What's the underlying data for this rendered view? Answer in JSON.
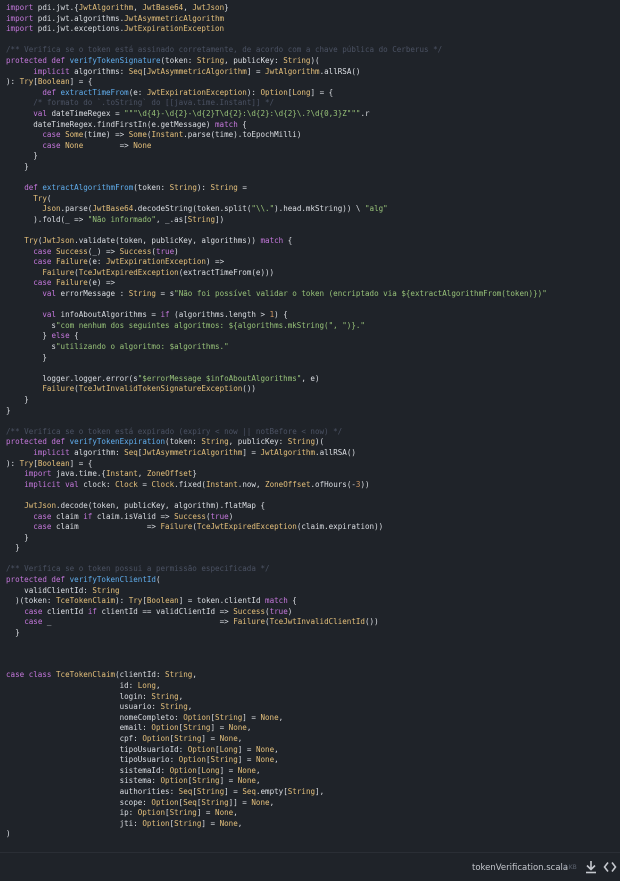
{
  "file": {
    "name": "tokenVerification.scala",
    "size": "4 KB"
  },
  "icons": {
    "download": "download-icon",
    "embed": "code-embed-icon"
  },
  "colors": {
    "background": "#1f2329",
    "keyword": "#c678dd",
    "function": "#61afef",
    "type": "#e5c07b",
    "string": "#98c379",
    "comment": "#4b5263",
    "number": "#d19a66",
    "plain": "#dcdfe4"
  },
  "code_lines": [
    [
      [
        "kw",
        "import"
      ],
      [
        "pl",
        " pdi.jwt.{"
      ],
      [
        "ty",
        "JwtAlgorithm"
      ],
      [
        "pl",
        ", "
      ],
      [
        "ty",
        "JwtBase64"
      ],
      [
        "pl",
        ", "
      ],
      [
        "ty",
        "JwtJson"
      ],
      [
        "pl",
        "}"
      ]
    ],
    [
      [
        "kw",
        "import"
      ],
      [
        "pl",
        " pdi.jwt.algorithms."
      ],
      [
        "ty",
        "JwtAsymmetricAlgorithm"
      ]
    ],
    [
      [
        "kw",
        "import"
      ],
      [
        "pl",
        " pdi.jwt.exceptions."
      ],
      [
        "ty",
        "JwtExpirationException"
      ]
    ],
    [],
    [
      [
        "cm",
        "/** Verifica se o token está assinado corretamente, de acordo com a chave pública do Cerberus */"
      ]
    ],
    [
      [
        "kw",
        "protected def "
      ],
      [
        "fn",
        "verifyTokenSignature"
      ],
      [
        "pl",
        "(token: "
      ],
      [
        "ty",
        "String"
      ],
      [
        "pl",
        ", publicKey: "
      ],
      [
        "ty",
        "String"
      ],
      [
        "pl",
        ")("
      ]
    ],
    [
      [
        "pl",
        "      "
      ],
      [
        "kw",
        "implicit "
      ],
      [
        "pl",
        "algorithms: "
      ],
      [
        "ty",
        "Seq"
      ],
      [
        "pl",
        "["
      ],
      [
        "ty",
        "JwtAsymmetricAlgorithm"
      ],
      [
        "pl",
        "] = "
      ],
      [
        "ty",
        "JwtAlgorithm"
      ],
      [
        "pl",
        ".allRSA()"
      ]
    ],
    [
      [
        "pl",
        "): "
      ],
      [
        "ty",
        "Try"
      ],
      [
        "pl",
        "["
      ],
      [
        "ty",
        "Boolean"
      ],
      [
        "pl",
        "] = {"
      ]
    ],
    [
      [
        "pl",
        "        "
      ],
      [
        "kw",
        "def "
      ],
      [
        "fn",
        "extractTimeFrom"
      ],
      [
        "pl",
        "(e: "
      ],
      [
        "ty",
        "JwtExpirationException"
      ],
      [
        "pl",
        "): "
      ],
      [
        "ty",
        "Option"
      ],
      [
        "pl",
        "["
      ],
      [
        "ty",
        "Long"
      ],
      [
        "pl",
        "] = {"
      ]
    ],
    [
      [
        "pl",
        "      "
      ],
      [
        "cm",
        "/* formato do `.toString` do [[java.time.Instant]] */"
      ]
    ],
    [
      [
        "pl",
        "      "
      ],
      [
        "kw",
        "val "
      ],
      [
        "pl",
        "dateTimeRegex = "
      ],
      [
        "st",
        "\"\"\"\\d{4}-\\d{2}-\\d{2}T\\d{2}:\\d{2}:\\d{2}\\.?\\d{0,3}Z\"\"\""
      ],
      [
        "pl",
        ".r"
      ]
    ],
    [
      [
        "pl",
        "      dateTimeRegex.findFirstIn(e.getMessage) "
      ],
      [
        "kw",
        "match"
      ],
      [
        "pl",
        " {"
      ]
    ],
    [
      [
        "pl",
        "        "
      ],
      [
        "kw",
        "case "
      ],
      [
        "ty",
        "Some"
      ],
      [
        "pl",
        "(time) => "
      ],
      [
        "ty",
        "Some"
      ],
      [
        "pl",
        "("
      ],
      [
        "ty",
        "Instant"
      ],
      [
        "pl",
        ".parse(time).toEpochMilli)"
      ]
    ],
    [
      [
        "pl",
        "        "
      ],
      [
        "kw",
        "case "
      ],
      [
        "ty",
        "None"
      ],
      [
        "pl",
        "        => "
      ],
      [
        "ty",
        "None"
      ]
    ],
    [
      [
        "pl",
        "      }"
      ]
    ],
    [
      [
        "pl",
        "    }"
      ]
    ],
    [],
    [
      [
        "pl",
        "    "
      ],
      [
        "kw",
        "def "
      ],
      [
        "fn",
        "extractAlgorithmFrom"
      ],
      [
        "pl",
        "(token: "
      ],
      [
        "ty",
        "String"
      ],
      [
        "pl",
        "): "
      ],
      [
        "ty",
        "String"
      ],
      [
        "pl",
        " ="
      ]
    ],
    [
      [
        "pl",
        "      "
      ],
      [
        "ty",
        "Try"
      ],
      [
        "pl",
        "("
      ]
    ],
    [
      [
        "pl",
        "        "
      ],
      [
        "ty",
        "Json"
      ],
      [
        "pl",
        ".parse("
      ],
      [
        "ty",
        "JwtBase64"
      ],
      [
        "pl",
        ".decodeString(token.split("
      ],
      [
        "st",
        "\"\\\\.\""
      ],
      [
        "pl",
        ").head.mkString)) \\ "
      ],
      [
        "st",
        "\"alg\""
      ]
    ],
    [
      [
        "pl",
        "      ).fold(_ => "
      ],
      [
        "st",
        "\"Não informado\""
      ],
      [
        "pl",
        ", _.as["
      ],
      [
        "ty",
        "String"
      ],
      [
        "pl",
        "])"
      ]
    ],
    [],
    [
      [
        "pl",
        "    "
      ],
      [
        "ty",
        "Try"
      ],
      [
        "pl",
        "("
      ],
      [
        "ty",
        "JwtJson"
      ],
      [
        "pl",
        ".validate(token, publicKey, algorithms)) "
      ],
      [
        "kw",
        "match"
      ],
      [
        "pl",
        " {"
      ]
    ],
    [
      [
        "pl",
        "      "
      ],
      [
        "kw",
        "case "
      ],
      [
        "ty",
        "Success"
      ],
      [
        "pl",
        "(_) => "
      ],
      [
        "ty",
        "Success"
      ],
      [
        "pl",
        "("
      ],
      [
        "kw",
        "true"
      ],
      [
        "pl",
        ")"
      ]
    ],
    [
      [
        "pl",
        "      "
      ],
      [
        "kw",
        "case "
      ],
      [
        "ty",
        "Failure"
      ],
      [
        "pl",
        "(e: "
      ],
      [
        "ty",
        "JwtExpirationException"
      ],
      [
        "pl",
        ") =>"
      ]
    ],
    [
      [
        "pl",
        "        "
      ],
      [
        "ty",
        "Failure"
      ],
      [
        "pl",
        "("
      ],
      [
        "ty",
        "TceJwtExpiredException"
      ],
      [
        "pl",
        "(extractTimeFrom(e)))"
      ]
    ],
    [
      [
        "pl",
        "      "
      ],
      [
        "kw",
        "case "
      ],
      [
        "ty",
        "Failure"
      ],
      [
        "pl",
        "(e) =>"
      ]
    ],
    [
      [
        "pl",
        "        "
      ],
      [
        "kw",
        "val "
      ],
      [
        "pl",
        "errorMessage : "
      ],
      [
        "ty",
        "String"
      ],
      [
        "pl",
        " = s"
      ],
      [
        "st",
        "\"Não foi possível validar o token (encriptado via ${extractAlgorithmFrom(token)})\""
      ]
    ],
    [],
    [
      [
        "pl",
        "        "
      ],
      [
        "kw",
        "val "
      ],
      [
        "pl",
        "infoAboutAlgorithms = "
      ],
      [
        "kw",
        "if"
      ],
      [
        "pl",
        " (algorithms.length > "
      ],
      [
        "nm",
        "1"
      ],
      [
        "pl",
        ") {"
      ]
    ],
    [
      [
        "pl",
        "          s"
      ],
      [
        "st",
        "\"com nenhum dos seguintes algoritmos: ${algorithms.mkString(\", \")}.\""
      ]
    ],
    [
      [
        "pl",
        "        } "
      ],
      [
        "kw",
        "else"
      ],
      [
        "pl",
        " {"
      ]
    ],
    [
      [
        "pl",
        "          s"
      ],
      [
        "st",
        "\"utilizando o algoritmo: $algorithms.\""
      ]
    ],
    [
      [
        "pl",
        "        }"
      ]
    ],
    [],
    [
      [
        "pl",
        "        logger.logger.error(s"
      ],
      [
        "st",
        "\"$errorMessage $infoAboutAlgorithms\""
      ],
      [
        "pl",
        ", e)"
      ]
    ],
    [
      [
        "pl",
        "        "
      ],
      [
        "ty",
        "Failure"
      ],
      [
        "pl",
        "("
      ],
      [
        "ty",
        "TceJwtInvalidTokenSignatureException"
      ],
      [
        "pl",
        "())"
      ]
    ],
    [
      [
        "pl",
        "    }"
      ]
    ],
    [
      [
        "pl",
        "}"
      ]
    ],
    [],
    [
      [
        "cm",
        "/** Verifica se o token está expirado (expiry < now || notBefore < now) */"
      ]
    ],
    [
      [
        "kw",
        "protected def "
      ],
      [
        "fn",
        "verifyTokenExpiration"
      ],
      [
        "pl",
        "(token: "
      ],
      [
        "ty",
        "String"
      ],
      [
        "pl",
        ", publicKey: "
      ],
      [
        "ty",
        "String"
      ],
      [
        "pl",
        ")("
      ]
    ],
    [
      [
        "pl",
        "      "
      ],
      [
        "kw",
        "implicit "
      ],
      [
        "pl",
        "algorithm: "
      ],
      [
        "ty",
        "Seq"
      ],
      [
        "pl",
        "["
      ],
      [
        "ty",
        "JwtAsymmetricAlgorithm"
      ],
      [
        "pl",
        "] = "
      ],
      [
        "ty",
        "JwtAlgorithm"
      ],
      [
        "pl",
        ".allRSA()"
      ]
    ],
    [
      [
        "pl",
        "): "
      ],
      [
        "ty",
        "Try"
      ],
      [
        "pl",
        "["
      ],
      [
        "ty",
        "Boolean"
      ],
      [
        "pl",
        "] = {"
      ]
    ],
    [
      [
        "pl",
        "    "
      ],
      [
        "kw",
        "import"
      ],
      [
        "pl",
        " java.time.{"
      ],
      [
        "ty",
        "Instant"
      ],
      [
        "pl",
        ", "
      ],
      [
        "ty",
        "ZoneOffset"
      ],
      [
        "pl",
        "}"
      ]
    ],
    [
      [
        "pl",
        "    "
      ],
      [
        "kw",
        "implicit val "
      ],
      [
        "pl",
        "clock: "
      ],
      [
        "ty",
        "Clock"
      ],
      [
        "pl",
        " = "
      ],
      [
        "ty",
        "Clock"
      ],
      [
        "pl",
        ".fixed("
      ],
      [
        "ty",
        "Instant"
      ],
      [
        "pl",
        ".now, "
      ],
      [
        "ty",
        "ZoneOffset"
      ],
      [
        "pl",
        ".ofHours(-"
      ],
      [
        "nm",
        "3"
      ],
      [
        "pl",
        "))"
      ]
    ],
    [],
    [
      [
        "pl",
        "    "
      ],
      [
        "ty",
        "JwtJson"
      ],
      [
        "pl",
        ".decode(token, publicKey, algorithm).flatMap {"
      ]
    ],
    [
      [
        "pl",
        "      "
      ],
      [
        "kw",
        "case "
      ],
      [
        "pl",
        "claim "
      ],
      [
        "kw",
        "if"
      ],
      [
        "pl",
        " claim.isValid => "
      ],
      [
        "ty",
        "Success"
      ],
      [
        "pl",
        "("
      ],
      [
        "kw",
        "true"
      ],
      [
        "pl",
        ")"
      ]
    ],
    [
      [
        "pl",
        "      "
      ],
      [
        "kw",
        "case "
      ],
      [
        "pl",
        "claim               => "
      ],
      [
        "ty",
        "Failure"
      ],
      [
        "pl",
        "("
      ],
      [
        "ty",
        "TceJwtExpiredException"
      ],
      [
        "pl",
        "(claim.expiration))"
      ]
    ],
    [
      [
        "pl",
        "    }"
      ]
    ],
    [
      [
        "pl",
        "  }"
      ]
    ],
    [],
    [
      [
        "cm",
        "/** Verifica se o token possui a permissão especificada */"
      ]
    ],
    [
      [
        "kw",
        "protected def "
      ],
      [
        "fn",
        "verifyTokenClientId"
      ],
      [
        "pl",
        "("
      ]
    ],
    [
      [
        "pl",
        "    validClientId: "
      ],
      [
        "ty",
        "String"
      ]
    ],
    [
      [
        "pl",
        "  )(token: "
      ],
      [
        "ty",
        "TceTokenClaim"
      ],
      [
        "pl",
        "): "
      ],
      [
        "ty",
        "Try"
      ],
      [
        "pl",
        "["
      ],
      [
        "ty",
        "Boolean"
      ],
      [
        "pl",
        "] = token.clientId "
      ],
      [
        "kw",
        "match"
      ],
      [
        "pl",
        " {"
      ]
    ],
    [
      [
        "pl",
        "    "
      ],
      [
        "kw",
        "case "
      ],
      [
        "pl",
        "clientId "
      ],
      [
        "kw",
        "if"
      ],
      [
        "pl",
        " clientId == validClientId => "
      ],
      [
        "ty",
        "Success"
      ],
      [
        "pl",
        "("
      ],
      [
        "kw",
        "true"
      ],
      [
        "pl",
        ")"
      ]
    ],
    [
      [
        "pl",
        "    "
      ],
      [
        "kw",
        "case "
      ],
      [
        "pl",
        "_                                     => "
      ],
      [
        "ty",
        "Failure"
      ],
      [
        "pl",
        "("
      ],
      [
        "ty",
        "TceJwtInvalidClientId"
      ],
      [
        "pl",
        "())"
      ]
    ],
    [
      [
        "pl",
        "  }"
      ]
    ],
    [],
    [],
    [],
    [
      [
        "kw",
        "case class "
      ],
      [
        "ty",
        "TceTokenClaim"
      ],
      [
        "pl",
        "(clientId: "
      ],
      [
        "ty",
        "String"
      ],
      [
        "pl",
        ","
      ]
    ],
    [
      [
        "pl",
        "                         id: "
      ],
      [
        "ty",
        "Long"
      ],
      [
        "pl",
        ","
      ]
    ],
    [
      [
        "pl",
        "                         login: "
      ],
      [
        "ty",
        "String"
      ],
      [
        "pl",
        ","
      ]
    ],
    [
      [
        "pl",
        "                         usuario: "
      ],
      [
        "ty",
        "String"
      ],
      [
        "pl",
        ","
      ]
    ],
    [
      [
        "pl",
        "                         nomeCompleto: "
      ],
      [
        "ty",
        "Option"
      ],
      [
        "pl",
        "["
      ],
      [
        "ty",
        "String"
      ],
      [
        "pl",
        "] = "
      ],
      [
        "ty",
        "None"
      ],
      [
        "pl",
        ","
      ]
    ],
    [
      [
        "pl",
        "                         email: "
      ],
      [
        "ty",
        "Option"
      ],
      [
        "pl",
        "["
      ],
      [
        "ty",
        "String"
      ],
      [
        "pl",
        "] = "
      ],
      [
        "ty",
        "None"
      ],
      [
        "pl",
        ","
      ]
    ],
    [
      [
        "pl",
        "                         cpf: "
      ],
      [
        "ty",
        "Option"
      ],
      [
        "pl",
        "["
      ],
      [
        "ty",
        "String"
      ],
      [
        "pl",
        "] = "
      ],
      [
        "ty",
        "None"
      ],
      [
        "pl",
        ","
      ]
    ],
    [
      [
        "pl",
        "                         tipoUsuarioId: "
      ],
      [
        "ty",
        "Option"
      ],
      [
        "pl",
        "["
      ],
      [
        "ty",
        "Long"
      ],
      [
        "pl",
        "] = "
      ],
      [
        "ty",
        "None"
      ],
      [
        "pl",
        ","
      ]
    ],
    [
      [
        "pl",
        "                         tipoUsuario: "
      ],
      [
        "ty",
        "Option"
      ],
      [
        "pl",
        "["
      ],
      [
        "ty",
        "String"
      ],
      [
        "pl",
        "] = "
      ],
      [
        "ty",
        "None"
      ],
      [
        "pl",
        ","
      ]
    ],
    [
      [
        "pl",
        "                         sistemaId: "
      ],
      [
        "ty",
        "Option"
      ],
      [
        "pl",
        "["
      ],
      [
        "ty",
        "Long"
      ],
      [
        "pl",
        "] = "
      ],
      [
        "ty",
        "None"
      ],
      [
        "pl",
        ","
      ]
    ],
    [
      [
        "pl",
        "                         sistema: "
      ],
      [
        "ty",
        "Option"
      ],
      [
        "pl",
        "["
      ],
      [
        "ty",
        "String"
      ],
      [
        "pl",
        "] = "
      ],
      [
        "ty",
        "None"
      ],
      [
        "pl",
        ","
      ]
    ],
    [
      [
        "pl",
        "                         authorities: "
      ],
      [
        "ty",
        "Seq"
      ],
      [
        "pl",
        "["
      ],
      [
        "ty",
        "String"
      ],
      [
        "pl",
        "] = "
      ],
      [
        "ty",
        "Seq"
      ],
      [
        "pl",
        ".empty["
      ],
      [
        "ty",
        "String"
      ],
      [
        "pl",
        "],"
      ]
    ],
    [
      [
        "pl",
        "                         scope: "
      ],
      [
        "ty",
        "Option"
      ],
      [
        "pl",
        "["
      ],
      [
        "ty",
        "Seq"
      ],
      [
        "pl",
        "["
      ],
      [
        "ty",
        "String"
      ],
      [
        "pl",
        "]] = "
      ],
      [
        "ty",
        "None"
      ],
      [
        "pl",
        ","
      ]
    ],
    [
      [
        "pl",
        "                         ip: "
      ],
      [
        "ty",
        "Option"
      ],
      [
        "pl",
        "["
      ],
      [
        "ty",
        "String"
      ],
      [
        "pl",
        "] = "
      ],
      [
        "ty",
        "None"
      ],
      [
        "pl",
        ","
      ]
    ],
    [
      [
        "pl",
        "                         jti: "
      ],
      [
        "ty",
        "Option"
      ],
      [
        "pl",
        "["
      ],
      [
        "ty",
        "String"
      ],
      [
        "pl",
        "] = "
      ],
      [
        "ty",
        "None"
      ],
      [
        "pl",
        ","
      ]
    ],
    [
      [
        "pl",
        ")"
      ]
    ]
  ]
}
